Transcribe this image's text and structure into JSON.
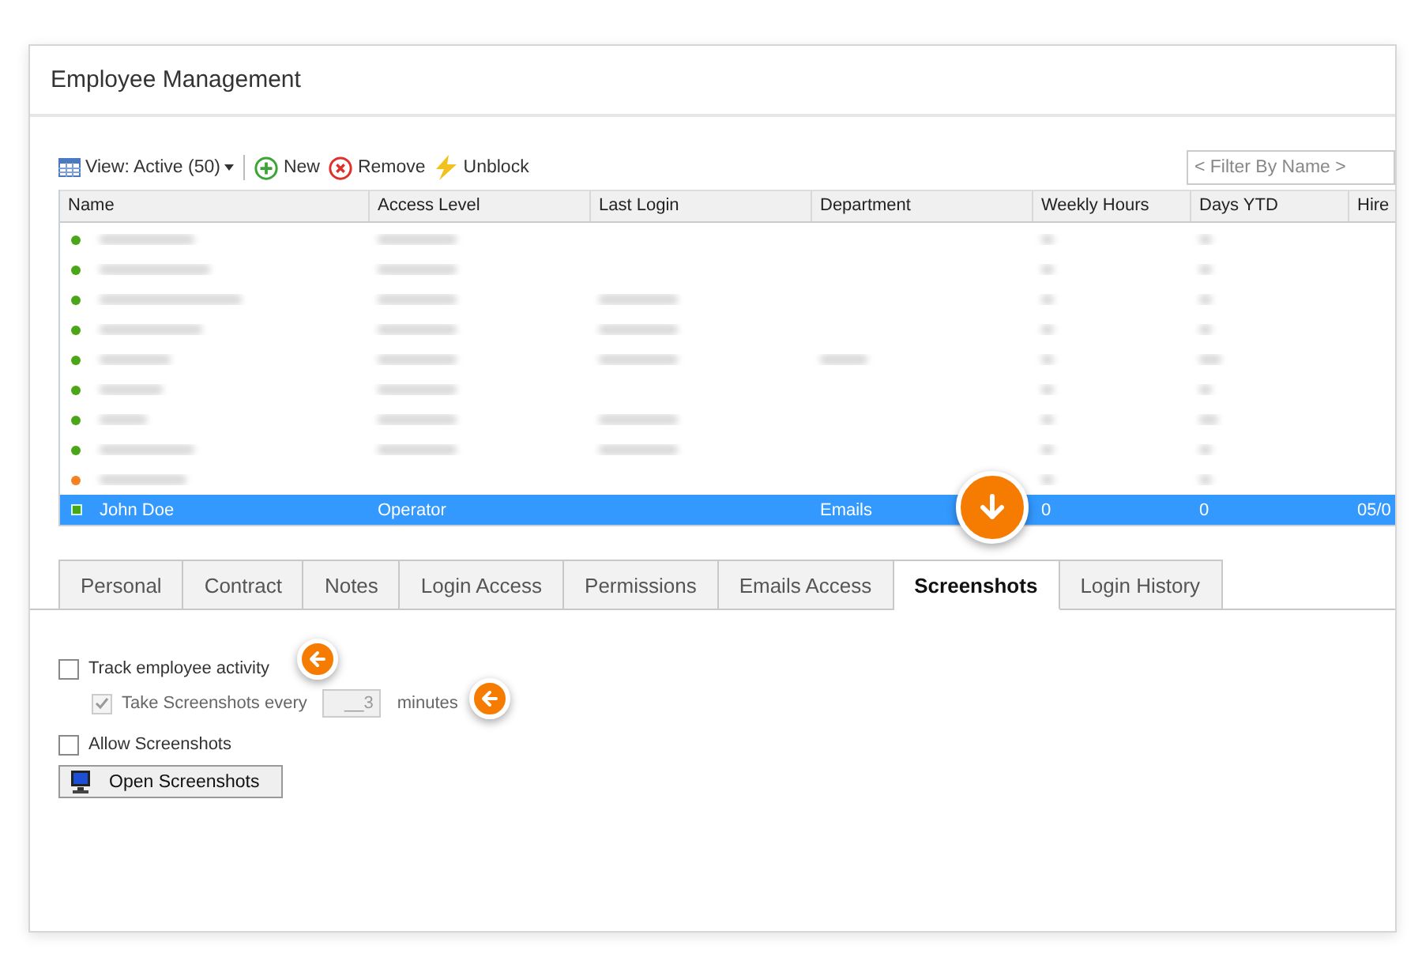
{
  "window": {
    "title": "Employee Management"
  },
  "toolbar": {
    "view": "View: Active (50)",
    "buttons": [
      {
        "kind": "new",
        "label": "New"
      },
      {
        "kind": "remove",
        "label": "Remove"
      },
      {
        "kind": "unblock",
        "label": "Unblock"
      }
    ],
    "filter": {
      "placeholder": "< Filter By Name >"
    }
  },
  "table": {
    "columns": [
      "Name",
      "Access Level",
      "Last Login",
      "Department",
      "Weekly Hours",
      "Days YTD",
      "Hire"
    ],
    "rows": [
      {
        "color": "#4aa517",
        "selected": false
      },
      {
        "color": "#4aa517",
        "selected": false
      },
      {
        "color": "#4aa517",
        "selected": false
      },
      {
        "color": "#4aa517",
        "selected": false
      },
      {
        "color": "#4aa517",
        "selected": false
      },
      {
        "color": "#4aa517",
        "selected": false
      },
      {
        "color": "#4aa517",
        "selected": false
      },
      {
        "color": "#4aa517",
        "selected": false
      },
      {
        "color": "#f58220",
        "selected": false
      },
      {
        "color": "#4aa517",
        "selected": true,
        "cells": [
          "John Doe",
          "Operator",
          "",
          "Emails",
          "0",
          "0",
          "05/0"
        ]
      }
    ]
  },
  "tabs": [
    {
      "label": "Personal",
      "selected": false
    },
    {
      "label": "Contract",
      "selected": false
    },
    {
      "label": "Notes",
      "selected": false
    },
    {
      "label": "Login Access",
      "selected": false
    },
    {
      "label": "Permissions",
      "selected": false
    },
    {
      "label": "Emails Access",
      "selected": false
    },
    {
      "label": "Screenshots",
      "selected": true
    },
    {
      "label": "Login History",
      "selected": false
    }
  ],
  "settings": {
    "track": {
      "label": "Track employee activity",
      "checked": false
    },
    "take": {
      "label": "Take Screenshots every",
      "checked": true,
      "disabled": true,
      "value": "__3",
      "unit": "minutes"
    },
    "allow": {
      "label": "Allow Screenshots",
      "checked": false
    },
    "open_button": "Open Screenshots"
  }
}
